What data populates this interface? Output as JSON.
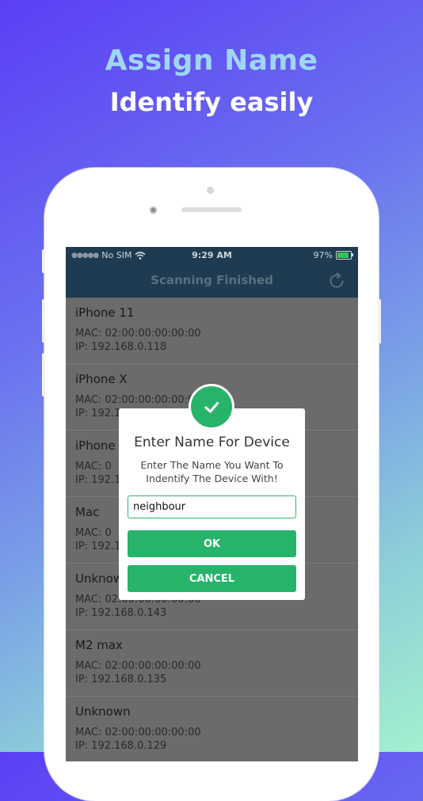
{
  "promo": {
    "title": "Assign Name",
    "subtitle": "Identify easily"
  },
  "status_bar": {
    "carrier": "No SIM",
    "time": "9:29 AM",
    "battery_text": "97%",
    "battery_level": 0.97
  },
  "nav": {
    "title": "Scanning Finished",
    "refresh_icon": "refresh-icon"
  },
  "devices": [
    {
      "name": "iPhone 11",
      "mac": "MAC: 02:00:00:00:00:00",
      "ip": "IP: 192.168.0.118"
    },
    {
      "name": "iPhone X",
      "mac": "MAC: 02:00:00:00:00:00",
      "ip": "IP: 192.1"
    },
    {
      "name": "iPhone",
      "mac": "MAC: 0",
      "ip": "IP: 192.1"
    },
    {
      "name": "Mac",
      "mac": "MAC: 0",
      "ip": "IP: 192.1"
    },
    {
      "name": "Unknow",
      "mac": "MAC: 02:00:00:00:00:00",
      "ip": "IP: 192.168.0.143"
    },
    {
      "name": "M2 max",
      "mac": "MAC: 02:00:00:00:00:00",
      "ip": "IP: 192.168.0.135"
    },
    {
      "name": "Unknown",
      "mac": "MAC: 02:00:00:00:00:00",
      "ip": "IP: 192.168.0.129"
    }
  ],
  "dialog": {
    "icon": "check-icon",
    "title": "Enter Name For Device",
    "message": "Enter The Name You Want To Indentify The Device With!",
    "input_value": "neighbour",
    "ok_label": "OK",
    "cancel_label": "CANCEL"
  },
  "colors": {
    "accent_green": "#28b36b",
    "nav_bg": "#1e3b52"
  }
}
